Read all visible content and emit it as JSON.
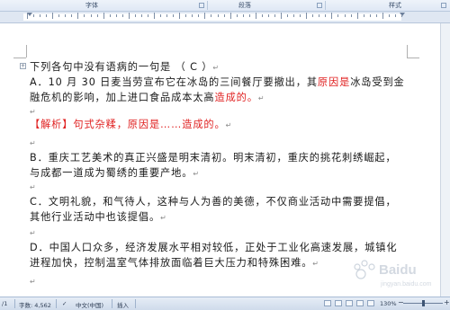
{
  "ribbon": {
    "groups": [
      "字体",
      "段落",
      "样式"
    ]
  },
  "document": {
    "question": "下列各句中没有语病的一句是  （  C  ）",
    "option_a": {
      "before": "A．10 月 30 日麦当劳宣布它在冰岛的三间餐厅要撤出，其",
      "red1": "原因是",
      "middle": "冰岛受到金融危机的影响，加上进口食品成本太高",
      "red2": "造成的。"
    },
    "analysis": "【解析】句式杂糅，原因是……造成的。",
    "option_b": "B．重庆工艺美术的真正兴盛是明末清初。明末清初，重庆的挑花刺绣崛起，与成都一道成为蜀绣的重要产地。",
    "option_c": "C．文明礼貌，和气待人，这种与人为善的美德，不仅商业活动中需要提倡，其他行业活动中也该提倡。",
    "option_d": "D．中国人口众多，经济发展水平相对较低，正处于工业化高速发展，城镇化进程加快，控制温室气体排放面临着巨大压力和特殊困难。",
    "paragraph_mark": "↵"
  },
  "status_bar": {
    "page": "/1",
    "word_count": "字数: 4,562",
    "language": "中文(中国)",
    "mode": "插入",
    "zoom": "130%",
    "zoom_level_fraction": 0.5
  },
  "watermark": {
    "brand": "Baidu",
    "sub": "jingyan.baidu.com"
  },
  "colors": {
    "accent_red": "#e02020",
    "ribbon": "#dfe8f5",
    "status": "#cfdbeb"
  }
}
